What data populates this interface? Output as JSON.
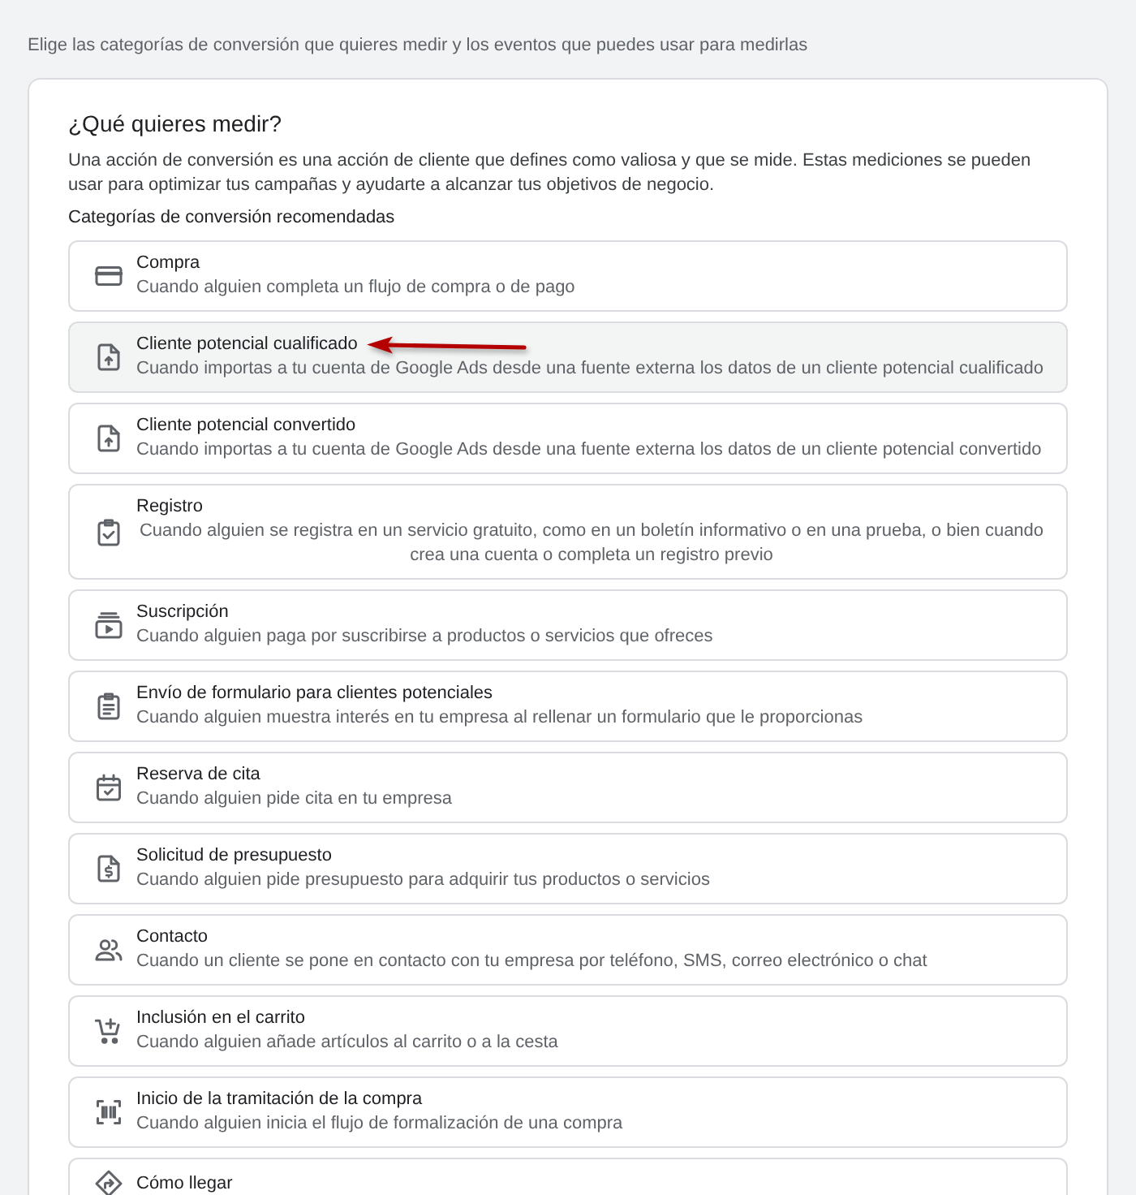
{
  "intro": "Elige las categorías de conversión que quieres medir y los eventos que puedes usar para medirlas",
  "card": {
    "title": "¿Qué quieres medir?",
    "description": "Una acción de conversión es una acción de cliente que defines como valiosa y que se mide. Estas mediciones se pueden usar para optimizar tus campañas y ayudarte a alcanzar tus objetivos de negocio.",
    "section_label": "Categorías de conversión recomendadas",
    "categories": [
      {
        "title": "Compra",
        "description": "Cuando alguien completa un flujo de compra o de pago",
        "selected": false,
        "annotated": false
      },
      {
        "title": "Cliente potencial cualificado",
        "description": "Cuando importas a tu cuenta de Google Ads desde una fuente externa los datos de un cliente potencial cualificado",
        "selected": true,
        "annotated": true
      },
      {
        "title": "Cliente potencial convertido",
        "description": "Cuando importas a tu cuenta de Google Ads desde una fuente externa los datos de un cliente potencial convertido",
        "selected": false,
        "annotated": false
      },
      {
        "title": "Registro",
        "description": "Cuando alguien se registra en un servicio gratuito, como en un boletín informativo o en una prueba, o bien cuando crea una cuenta o completa un registro previo",
        "selected": false,
        "annotated": false
      },
      {
        "title": "Suscripción",
        "description": "Cuando alguien paga por suscribirse a productos o servicios que ofreces",
        "selected": false,
        "annotated": false
      },
      {
        "title": "Envío de formulario para clientes potenciales",
        "description": "Cuando alguien muestra interés en tu empresa al rellenar un formulario que le proporcionas",
        "selected": false,
        "annotated": false
      },
      {
        "title": "Reserva de cita",
        "description": "Cuando alguien pide cita en tu empresa",
        "selected": false,
        "annotated": false
      },
      {
        "title": "Solicitud de presupuesto",
        "description": "Cuando alguien pide presupuesto para adquirir tus productos o servicios",
        "selected": false,
        "annotated": false
      },
      {
        "title": "Contacto",
        "description": "Cuando un cliente se pone en contacto con tu empresa por teléfono, SMS, correo electrónico o chat",
        "selected": false,
        "annotated": false
      },
      {
        "title": "Inclusión en el carrito",
        "description": "Cuando alguien añade artículos al carrito o a la cesta",
        "selected": false,
        "annotated": false
      },
      {
        "title": "Inicio de la tramitación de la compra",
        "description": "Cuando alguien inicia el flujo de formalización de una compra",
        "selected": false,
        "annotated": false
      },
      {
        "title": "Cómo llegar",
        "selected": false,
        "annotated": false
      }
    ]
  }
}
